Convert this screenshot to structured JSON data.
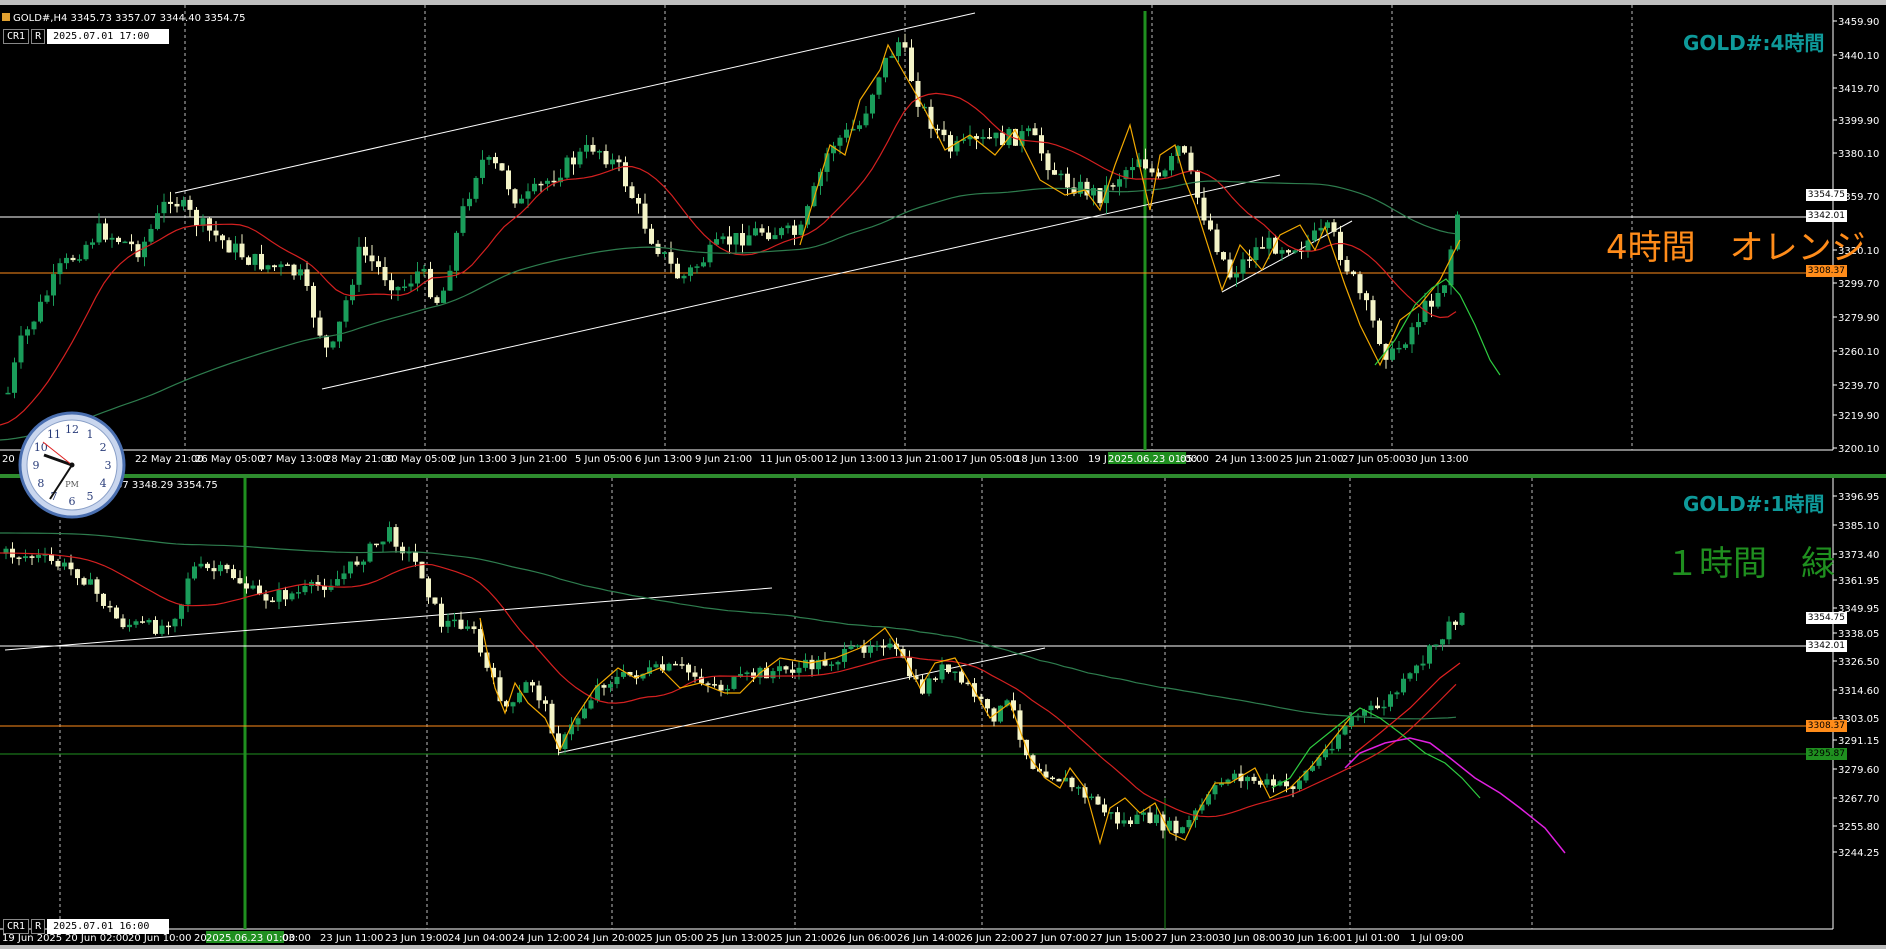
{
  "top": {
    "header": "GOLD#,H4  3345.73 3357.07 3344.40 3354.75",
    "cr_label": "CR1",
    "r_label": "R",
    "datetime": "2025.07.01 17:00",
    "title": "GOLD#:4時間",
    "overlay_text": "4時間　オレンジ",
    "price_axis": [
      "3459.90",
      "3440.10",
      "3419.70",
      "3399.90",
      "3380.10",
      "3359.70",
      "3320.10",
      "3299.70",
      "3279.90",
      "3260.10",
      "3239.70",
      "3219.90",
      "3200.10"
    ],
    "price_tags": {
      "current": "3354.75",
      "line1": "3342.01",
      "line2": "3308.37"
    },
    "time_axis": [
      "20",
      "22 May 21:00",
      "26 May 05:00",
      "27 May 13:00",
      "28 May 21:00",
      "30 May 05:00",
      "2 Jun 13:00",
      "3 Jun 21:00",
      "5 Jun 05:00",
      "6 Jun 13:00",
      "9 Jun 21:00",
      "11 Jun 05:00",
      "12 Jun 13:00",
      "13 Jun 21:00",
      "17 Jun 05:00",
      "18 Jun 13:00",
      "19 J",
      "2025.06.23 01:00",
      "05:00",
      "24 Jun 13:00",
      "25 Jun 21:00",
      "27 Jun 05:00",
      "30 Jun 13:00"
    ],
    "colors": {
      "accent": "#0e9a9a",
      "overlay": "#ff8c1a",
      "bull": "#1a9c5a",
      "bear": "#f4f4c8",
      "ma_red": "#d42020",
      "ma_green": "#2e7d4e",
      "vline": "#1f8f1f"
    }
  },
  "bottom": {
    "header": "07 3348.29 3354.75",
    "cr_label": "CR1",
    "r_label": "R",
    "datetime": "2025.07.01 16:00",
    "title": "GOLD#:1時間",
    "overlay_text": "１時間　緑",
    "price_axis": [
      "3396.95",
      "3385.10",
      "3373.40",
      "3361.95",
      "3349.95",
      "3338.05",
      "3326.50",
      "3314.60",
      "3303.05",
      "3291.15",
      "3279.60",
      "3267.70",
      "3255.80",
      "3244.25"
    ],
    "price_tags": {
      "current": "3354.75",
      "line1": "3342.01",
      "line2": "3308.37",
      "line3": "3295.87"
    },
    "time_axis": [
      "19 Jun 2025",
      "20 Jun 02:00",
      "20 Jun 10:00",
      "20",
      "2025.06.23 01:00",
      "03:00",
      "23 Jun 11:00",
      "23 Jun 19:00",
      "24 Jun 04:00",
      "24 Jun 12:00",
      "24 Jun 20:00",
      "25 Jun 05:00",
      "25 Jun 13:00",
      "25 Jun 21:00",
      "26 Jun 06:00",
      "26 Jun 14:00",
      "26 Jun 22:00",
      "27 Jun 07:00",
      "27 Jun 15:00",
      "27 Jun 23:00",
      "30 Jun 08:00",
      "30 Jun 16:00",
      "1 Jul 01:00",
      "1 Jul 09:00"
    ],
    "colors": {
      "accent": "#0e9a9a",
      "overlay": "#1f8f1f",
      "magenta": "#e020e0"
    }
  },
  "clock": {
    "label": "PM",
    "numbers": [
      "12",
      "1",
      "2",
      "3",
      "4",
      "5",
      "6",
      "7",
      "8",
      "9",
      "10",
      "11"
    ]
  }
}
